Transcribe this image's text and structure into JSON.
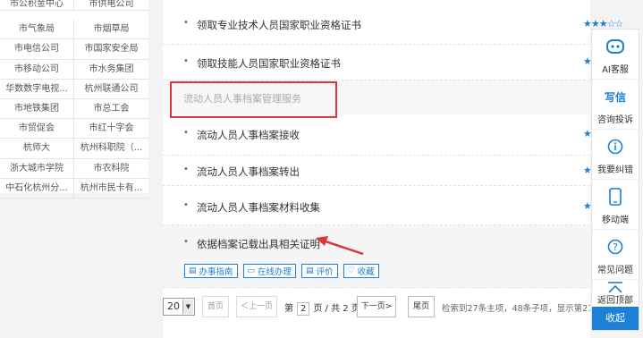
{
  "org_links": [
    "市公积金中心",
    "市供电公司",
    "市气象局",
    "市烟草局",
    "市电信公司",
    "市国家安全局",
    "市移动公司",
    "市水务集团",
    "华数数字电视...",
    "杭州联通公司",
    "市地铁集团",
    "市总工会",
    "市贸促会",
    "市红十字会",
    "杭师大",
    "杭州科职院（...",
    "浙大城市学院",
    "市农科院",
    "中石化杭州分...",
    "杭州市民卡有..."
  ],
  "services": {
    "item1": "领取专业技术人员国家职业资格证书",
    "item1_rating": "★★★☆☆",
    "item2": "领取技能人员国家职业资格证书",
    "section_title": "流动人员人事档案管理服务",
    "item3": "流动人员人事档案接收",
    "item4": "流动人员人事档案转出",
    "item5": "流动人员人事档案材料收集",
    "item6": "依据档案记载出具相关证明",
    "star": "★",
    "bullet": "•"
  },
  "actions": {
    "guide": "办事指南",
    "online": "在线办理",
    "rate": "评价",
    "favorite": "收藏"
  },
  "pagination": {
    "page_size": "20",
    "first": "首页",
    "prev": "＜上一页",
    "page_prefix": "第",
    "current_page": "2",
    "page_middle": "页 / 共",
    "total_pages": "2",
    "page_suffix": "页",
    "next": "下一页>",
    "last": "尾页",
    "summary": "检索到27条主项，48条子项，显示第21条-"
  },
  "sidebar": {
    "ai": "AI客服",
    "consult_icon_text": "写信",
    "consult": "咨询投诉",
    "correct": "我要纠错",
    "mobile": "移动端",
    "faq": "常见问题",
    "top": "返回顶部",
    "collapse": "收起"
  },
  "colors": {
    "accent": "#1d7fd6",
    "highlight_box": "#d9373a"
  }
}
